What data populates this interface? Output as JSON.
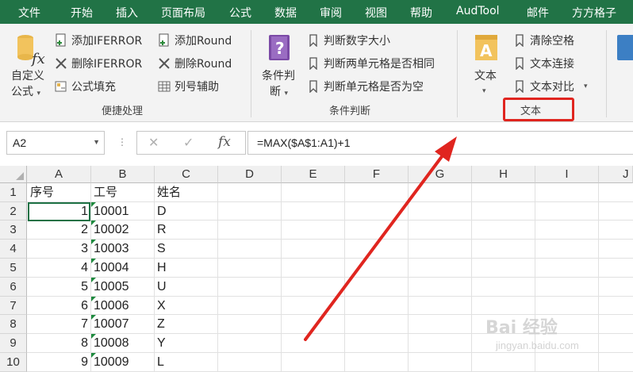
{
  "menu": {
    "tabs": [
      "文件",
      "开始",
      "插入",
      "页面布局",
      "公式",
      "数据",
      "审阅",
      "视图",
      "帮助",
      "AudTool",
      "邮件",
      "方方格子"
    ]
  },
  "ribbon": {
    "custom_formula": {
      "line1": "自定义",
      "line2": "公式"
    },
    "add_iferror": "添加IFERROR",
    "remove_iferror": "删除IFERROR",
    "formula_fill": "公式填充",
    "add_round": "添加Round",
    "remove_round": "删除Round",
    "column_helper": "列号辅助",
    "group_quick": "便捷处理",
    "condition": {
      "line1": "条件判",
      "line2": "断"
    },
    "judge_number": "判断数字大小",
    "judge_two_cells": "判断两单元格是否相同",
    "judge_empty": "判断单元格是否为空",
    "group_condition": "条件判断",
    "text_btn": "文本",
    "clear_spaces": "清除空格",
    "text_join": "文本连接",
    "text_compare": "文本对比",
    "group_text": "文本",
    "icons": {
      "custom_formula": "function-fx-icon",
      "add": "add-doc-icon",
      "remove": "delete-x-icon",
      "fill": "formula-fill-icon",
      "column": "grid-icon",
      "condition": "book-icon",
      "bookmark": "bookmark-icon",
      "text": "text-a-icon"
    }
  },
  "formula_bar": {
    "name_box": "A2",
    "cancel": "✕",
    "enter": "✓",
    "fx": "fx",
    "formula": "=MAX($A$1:A1)+1"
  },
  "sheet": {
    "columns": [
      "A",
      "B",
      "C",
      "D",
      "E",
      "F",
      "G",
      "H",
      "I",
      "J"
    ],
    "rows": [
      "1",
      "2",
      "3",
      "4",
      "5",
      "6",
      "7",
      "8",
      "9",
      "10"
    ],
    "headers": {
      "a": "序号",
      "b": "工号",
      "c": "姓名"
    },
    "data": [
      {
        "a": "1",
        "b": "10001",
        "c": "D"
      },
      {
        "a": "2",
        "b": "10002",
        "c": "R"
      },
      {
        "a": "3",
        "b": "10003",
        "c": "S"
      },
      {
        "a": "4",
        "b": "10004",
        "c": "H"
      },
      {
        "a": "5",
        "b": "10005",
        "c": "U"
      },
      {
        "a": "6",
        "b": "10006",
        "c": "X"
      },
      {
        "a": "7",
        "b": "10007",
        "c": "Z"
      },
      {
        "a": "8",
        "b": "10008",
        "c": "Y"
      },
      {
        "a": "9",
        "b": "10009",
        "c": "L"
      }
    ]
  },
  "watermark": {
    "brand": "Bai 经验",
    "url": "jingyan.baidu.com"
  },
  "colors": {
    "accent": "#217346",
    "highlight": "#e0251f",
    "arrow": "#e0251f"
  }
}
